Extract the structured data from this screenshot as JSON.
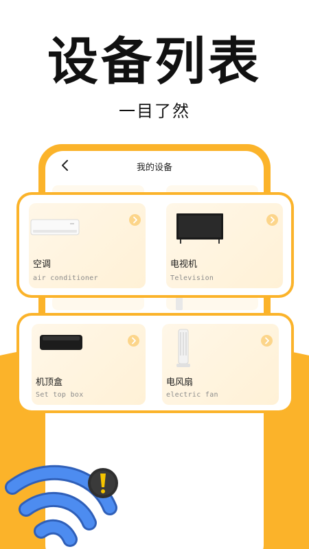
{
  "hero": {
    "title": "设备列表",
    "subtitle": "一目了然"
  },
  "screen": {
    "title": "我的设备"
  },
  "devices": [
    {
      "name": "空调",
      "subtitle": "air conditioner",
      "icon": "air-conditioner-icon"
    },
    {
      "name": "电视机",
      "subtitle": "Television",
      "icon": "television-icon"
    },
    {
      "name": "机顶盒",
      "subtitle": "Set top box",
      "icon": "set-top-box-icon"
    },
    {
      "name": "电风扇",
      "subtitle": "electric fan",
      "icon": "electric-fan-icon"
    }
  ],
  "colors": {
    "accent": "#FBB32A",
    "card_bg": "#FFF3DC",
    "wifi": "#3F7BE0",
    "warning": "#F5C400"
  }
}
